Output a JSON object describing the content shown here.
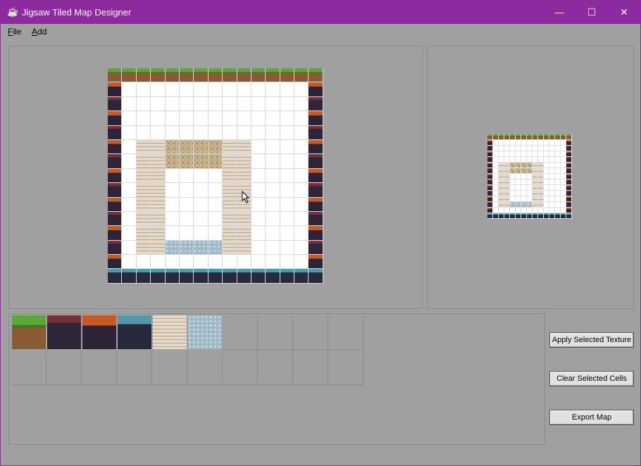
{
  "window": {
    "title": "Jigsaw Tiled Map Designer",
    "app_icon": "app-logo-icon",
    "controls": [
      "minimize-icon",
      "maximize-icon",
      "close-icon"
    ]
  },
  "menu": {
    "items": [
      {
        "label": "File",
        "mnemonic": "F"
      },
      {
        "label": "Add",
        "mnemonic": "A"
      }
    ]
  },
  "textures": [
    "grass",
    "dark",
    "lava",
    "ice",
    "brick",
    "sand",
    "water"
  ],
  "map": {
    "rows": 15,
    "cols": 15,
    "legend": {
      ".": "empty",
      "G": "grass",
      "D": "dark",
      "L": "lava",
      "I": "ice",
      "B": "brick",
      "S": "sand",
      "W": "water"
    },
    "cells": [
      "GGGGGGGGGGGGGGG",
      "L.............L",
      "D.............D",
      "L.............L",
      "D.............D",
      "L.BBSSSSBB....L",
      "D.BBSSSSBB....D",
      "L.BB....BB....L",
      "D.BB....BB....D",
      "L.BB....BB....L",
      "D.BB....BB....D",
      "L.BB....BB....L",
      "D.BBWWWWBB....D",
      "L.............L",
      "IIIIIIIIIIIIIII"
    ]
  },
  "palette": {
    "slots": [
      "grass",
      "dark",
      "lava",
      "ice",
      "brick",
      "water",
      "",
      "",
      "",
      "",
      "",
      "",
      "",
      "",
      "",
      "",
      "",
      "",
      "",
      ""
    ],
    "selected": "water"
  },
  "buttons": {
    "apply": "Apply Selected Texture",
    "clear": "Clear Selected Cells",
    "export": "Export Map"
  }
}
